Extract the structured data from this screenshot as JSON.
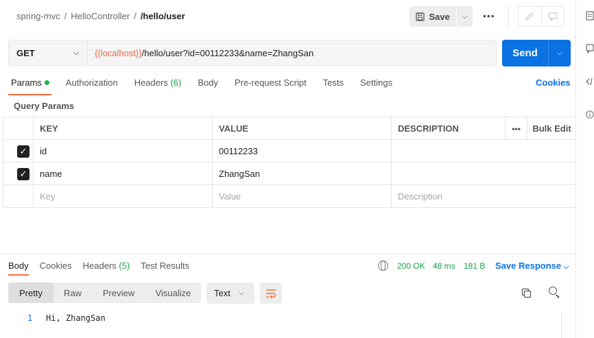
{
  "breadcrumb": {
    "collection": "spring-mvc",
    "folder": "HelloController",
    "request": "/hello/user",
    "separator": "/"
  },
  "toolbar": {
    "save_label": "Save",
    "more": "•••"
  },
  "request": {
    "method": "GET",
    "url_variable": "{{localhost}}",
    "url_rest": "/hello/user?id=00112233&name=ZhangSan",
    "send_label": "Send"
  },
  "request_tabs": [
    {
      "label": "Params",
      "active": true
    },
    {
      "label": "Authorization"
    },
    {
      "label": "Headers",
      "count": "(6)"
    },
    {
      "label": "Body"
    },
    {
      "label": "Pre-request Script"
    },
    {
      "label": "Tests"
    },
    {
      "label": "Settings"
    }
  ],
  "cookies_label": "Cookies",
  "query_params": {
    "title": "Query Params",
    "columns": {
      "key": "KEY",
      "value": "VALUE",
      "description": "DESCRIPTION",
      "more": "•••",
      "bulk_edit": "Bulk Edit"
    },
    "rows": [
      {
        "checked": true,
        "key": "id",
        "value": "00112233",
        "description": ""
      },
      {
        "checked": true,
        "key": "name",
        "value": "ZhangSan",
        "description": ""
      }
    ],
    "placeholder": {
      "key": "Key",
      "value": "Value",
      "description": "Description"
    }
  },
  "response": {
    "tabs": [
      {
        "label": "Body",
        "active": true
      },
      {
        "label": "Cookies"
      },
      {
        "label": "Headers",
        "count": "(5)"
      },
      {
        "label": "Test Results"
      }
    ],
    "status": "200 OK",
    "time": "48 ms",
    "size": "181 B",
    "save_response_label": "Save Response",
    "formats": [
      "Pretty",
      "Raw",
      "Preview",
      "Visualize"
    ],
    "content_type": "Text",
    "body_lines": [
      {
        "number": "1",
        "text": "Hi, ZhangSan"
      }
    ]
  },
  "colors": {
    "accent": "#ff6c37",
    "send": "#0a72e2",
    "variable": "#e8694a",
    "status_ok": "#17a34a"
  }
}
